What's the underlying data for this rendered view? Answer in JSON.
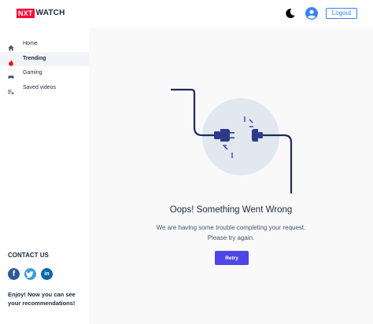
{
  "header": {
    "logo_nxt": "NXT",
    "logo_watch": "WATCH",
    "logout_label": "Logout"
  },
  "sidebar": {
    "items": [
      {
        "label": "Home",
        "icon": "home-icon"
      },
      {
        "label": "Trending",
        "icon": "fire-icon",
        "active": true
      },
      {
        "label": "Gaming",
        "icon": "gamepad-icon"
      },
      {
        "label": "Saved videos",
        "icon": "playlist-add-icon"
      }
    ],
    "contact_title": "CONTACT US",
    "contact_text": "Enjoy! Now you can see your recommendations!"
  },
  "main": {
    "failure_title": "Oops! Something Went Wrong",
    "failure_line1": "We are having some trouble completing your request.",
    "failure_line2": "Please try again.",
    "retry_label": "Retry"
  },
  "colors": {
    "brand_red": "#ff0b37",
    "accent_blue": "#3b82f6",
    "retry_indigo": "#4f46e5",
    "trending_red": "#ff0000"
  }
}
